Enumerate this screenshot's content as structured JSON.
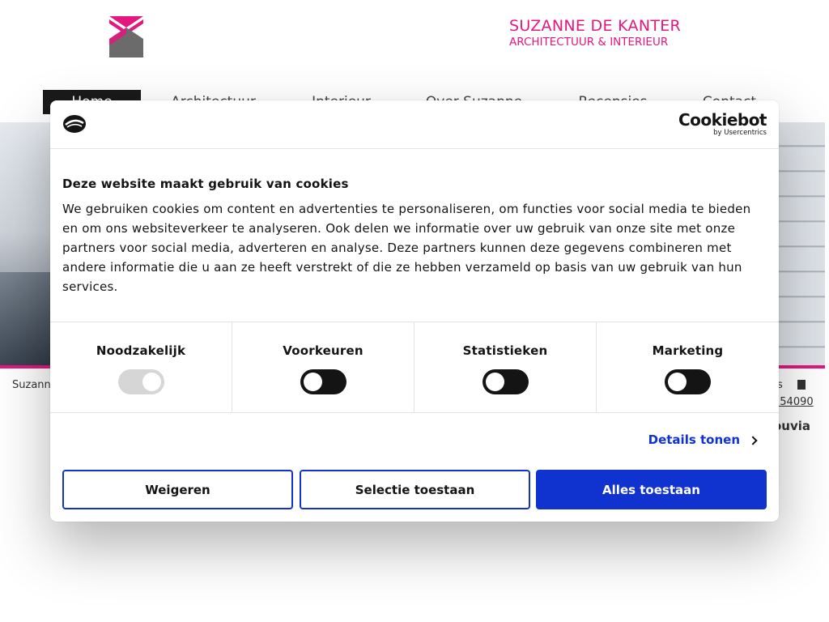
{
  "site": {
    "brand_name": "SUZANNE DE KANTER",
    "brand_sub": "ARCHITECTUUR & INTERIEUR",
    "nav": [
      "Home",
      "Architectuur",
      "Interieur",
      "Over Suzanne",
      "Recensies",
      "Contact"
    ],
    "nav_active": "Home",
    "footer_left": "Suzann",
    "footer_right_s": "s",
    "footer_phone": "154090",
    "footer_brand": "ouvia",
    "colors": {
      "accent": "#e2187f",
      "nav_active_bg": "#1a1a1a"
    }
  },
  "cookie_dialog": {
    "logo_main": "Cookiebot",
    "logo_sub": "by Usercentrics",
    "title": "Deze website maakt gebruik van cookies",
    "text": "We gebruiken cookies om content en advertenties te personaliseren, om functies voor social media te bieden en om ons websiteverkeer te analyseren. Ook delen we informatie over uw gebruik van onze site met onze partners voor social media, adverteren en analyse. Deze partners kunnen deze gegevens combineren met andere informatie die u aan ze heeft verstrekt of die ze hebben verzameld op basis van uw gebruik van hun services.",
    "categories": [
      {
        "label": "Noodzakelijk",
        "checked": true,
        "disabled": true
      },
      {
        "label": "Voorkeuren",
        "checked": false,
        "disabled": false
      },
      {
        "label": "Statistieken",
        "checked": false,
        "disabled": false
      },
      {
        "label": "Marketing",
        "checked": false,
        "disabled": false
      }
    ],
    "details_label": "Details tonen",
    "buttons": {
      "deny": "Weigeren",
      "select": "Selectie toestaan",
      "allow_all": "Alles toestaan"
    },
    "colors": {
      "primary": "#1032cf",
      "text": "#141414"
    }
  }
}
